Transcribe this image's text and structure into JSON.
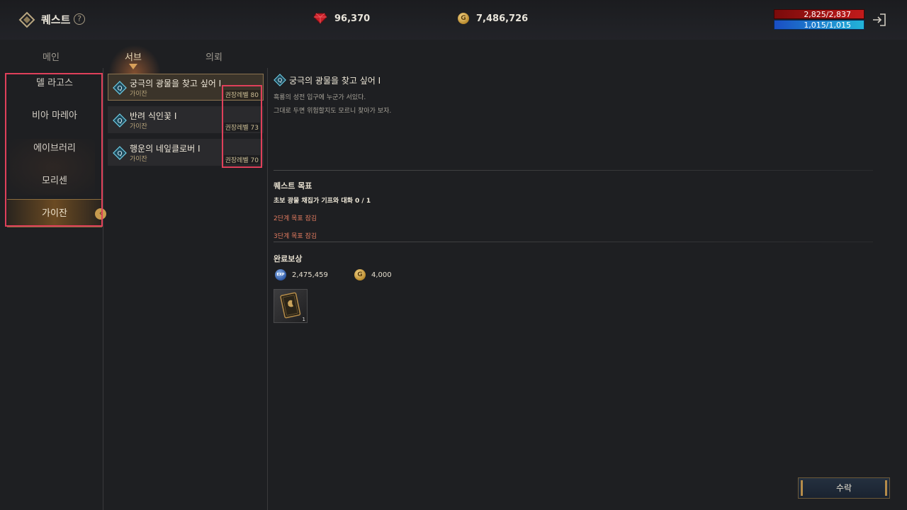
{
  "header": {
    "title": "퀘스트",
    "help_icon": "?",
    "gems": "96,370",
    "gold": "7,486,726",
    "hp": "2,825/2,837",
    "mp": "1,015/1,015"
  },
  "tabs": [
    {
      "label": "메인"
    },
    {
      "label": "서브"
    },
    {
      "label": "의뢰"
    }
  ],
  "regions": [
    {
      "label": "델 라고스"
    },
    {
      "label": "비아 마레아"
    },
    {
      "label": "에이브러리"
    },
    {
      "label": "모리센"
    },
    {
      "label": "가이잔"
    }
  ],
  "quests": [
    {
      "name": "궁극의 광물을 찾고 싶어 Ⅰ",
      "region": "가이잔",
      "level": "권장레벨 80"
    },
    {
      "name": "반려 식인꽃 Ⅰ",
      "region": "가이잔",
      "level": "권장레벨 73"
    },
    {
      "name": "행운의 네잎클로버 Ⅰ",
      "region": "가이잔",
      "level": "권장레벨 70"
    }
  ],
  "detail": {
    "title": "궁극의 광물을 찾고 싶어 Ⅰ",
    "desc1": "흑룡의 성전 입구에 누군가 서있다.",
    "desc2": "그대로 두면 위험할지도 모르니 찾아가 보자.",
    "objective_header": "퀘스트 목표",
    "objective_main": "초보 광물 채집가 기프와 대화 0 / 1",
    "objective_locked_2": "2단계 목표 잠김",
    "objective_locked_3": "3단계 목표 잠김",
    "reward_header": "완료보상",
    "reward_exp": "2,475,459",
    "reward_gold": "4,000",
    "reward_item_count": "1",
    "exp_badge": "EXP",
    "coin_glyph": "G"
  },
  "accept_button": "수락",
  "colors": {
    "accent_gold": "#c79b4e",
    "locked_red": "#e07a5f",
    "annotation": "#e0405a"
  }
}
